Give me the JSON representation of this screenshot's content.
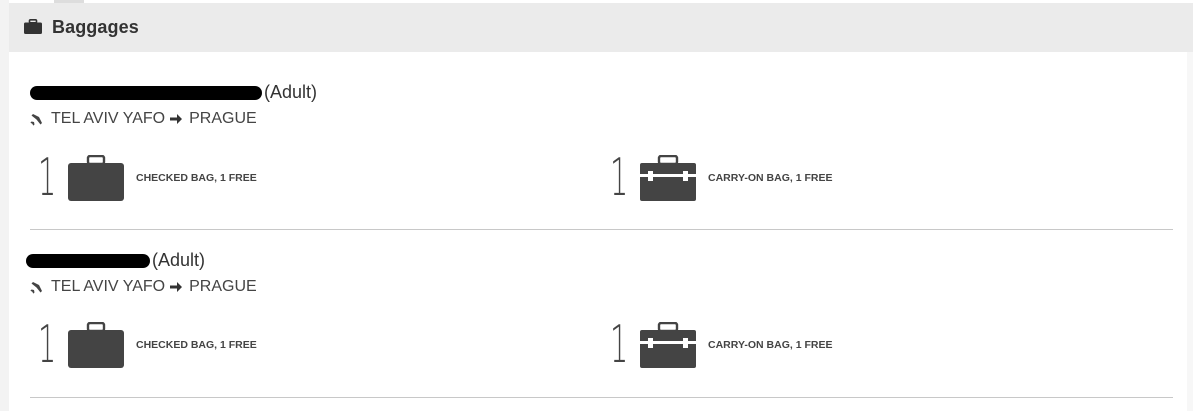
{
  "panel": {
    "title": "Baggages",
    "icon": "briefcase-icon"
  },
  "passengers": [
    {
      "name_suffix": "(Adult)",
      "route": {
        "from": "TEL AVIV YAFO",
        "to": "PRAGUE"
      },
      "checked": {
        "count": "1",
        "label": "CHECKED BAG, 1 FREE"
      },
      "carry": {
        "count": "1",
        "label": "CARRY-ON BAG, 1 FREE"
      }
    },
    {
      "name_suffix": "(Adult)",
      "route": {
        "from": "TEL AVIV YAFO",
        "to": "PRAGUE"
      },
      "checked": {
        "count": "1",
        "label": "CHECKED BAG, 1 FREE"
      },
      "carry": {
        "count": "1",
        "label": "CARRY-ON BAG, 1 FREE"
      }
    }
  ],
  "colors": {
    "header_bg": "#ebebeb",
    "text": "#333333",
    "icon": "#444444",
    "divider": "#c8c8c8"
  }
}
